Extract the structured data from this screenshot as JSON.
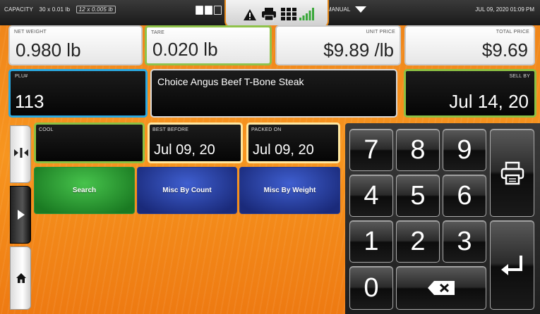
{
  "status": {
    "capacity_label": "CAPACITY",
    "capacity_value_1": "30 x 0.01 lb",
    "capacity_value_2": "12 x 0.005 lb",
    "mode": "MANUAL",
    "datetime": "JUL 09, 2020 01:09 PM"
  },
  "fields": {
    "net_weight": {
      "label": "NET WEIGHT",
      "value": "0.980 lb"
    },
    "tare": {
      "label": "TARE",
      "value": "0.020 lb"
    },
    "unit_price": {
      "label": "UNIT PRICE",
      "value": "$9.89 /lb"
    },
    "total_price": {
      "label": "TOTAL PRICE",
      "value": "$9.69"
    },
    "plu": {
      "label": "PLU#",
      "value": "113"
    },
    "description": {
      "value": "Choice Angus Beef T-Bone Steak"
    },
    "sell_by": {
      "label": "SELL BY",
      "value": "Jul 14, 20"
    },
    "cool": {
      "label": "COOL",
      "value": ""
    },
    "best_before": {
      "label": "BEST BEFORE",
      "value": "Jul 09, 20"
    },
    "packed_on": {
      "label": "PACKED ON",
      "value": "Jul 09, 20"
    }
  },
  "buttons": {
    "search": "Search",
    "misc_count": "Misc By Count",
    "misc_weight": "Misc By Weight"
  },
  "keypad": {
    "k7": "7",
    "k8": "8",
    "k9": "9",
    "k4": "4",
    "k5": "5",
    "k6": "6",
    "k1": "1",
    "k2": "2",
    "k3": "3",
    "k0": "0"
  },
  "icons": [
    "warning-icon",
    "printer-icon",
    "grid-icon",
    "signal-icon",
    "zero-icon",
    "play-icon",
    "home-icon",
    "backspace-icon",
    "enter-icon"
  ],
  "colors": {
    "orange": "#f7951f",
    "blue_border": "#2aa8e0",
    "green_border": "#8cc043",
    "green_button": "#1f8a26",
    "blue_button": "#1f2f8a"
  }
}
